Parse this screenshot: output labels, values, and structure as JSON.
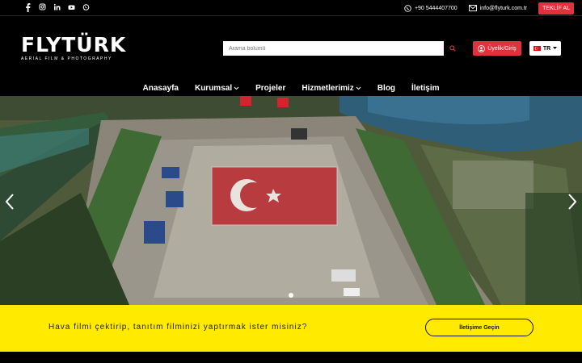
{
  "topbar": {
    "social": [
      "facebook-icon",
      "instagram-icon",
      "linkedin-icon",
      "youtube-icon",
      "whatsapp-icon"
    ],
    "phone": "+90 5444407700",
    "email": "info@flyturk.com.tr",
    "offer_label": "TEKLİF AL"
  },
  "header": {
    "logo_main": "FLYTÜRK",
    "logo_sub": "AERIAL FILM & PHOTOGRAPHY",
    "search_placeholder": "Arama bolumü",
    "login_label": "Üyelik/Giriş",
    "lang_label": "TR"
  },
  "nav": {
    "items": [
      {
        "label": "Anasayfa",
        "dropdown": false
      },
      {
        "label": "Kurumsal",
        "dropdown": true
      },
      {
        "label": "Projeler",
        "dropdown": false
      },
      {
        "label": "Hizmetlerimiz",
        "dropdown": true
      },
      {
        "label": "Blog",
        "dropdown": false
      },
      {
        "label": "İletişim",
        "dropdown": false
      }
    ]
  },
  "cta": {
    "text": "Hava filmi çektirip, tanıtım filminizi yaptırmak ister misiniz?",
    "button_label": "İletişime Geçin"
  },
  "colors": {
    "accent_red": "#e0313c",
    "cta_yellow": "#ffea00"
  }
}
